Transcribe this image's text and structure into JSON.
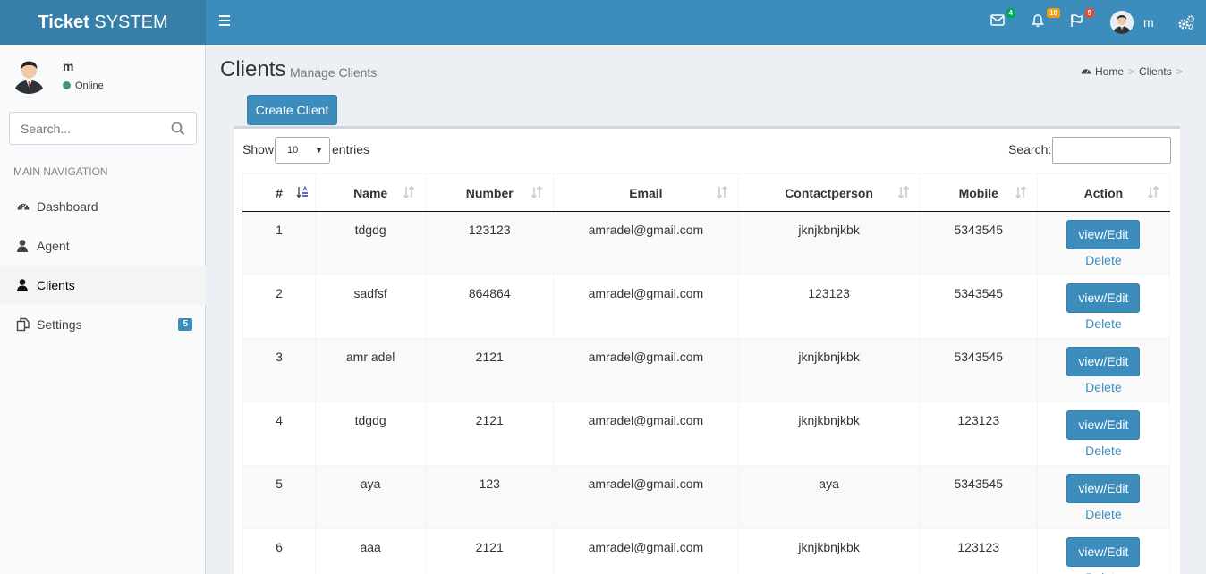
{
  "header": {
    "logo_bold": "Ticket",
    "logo_rest": "SYSTEM",
    "messages_count": "4",
    "notifications_count": "10",
    "tasks_count": "9",
    "user_name": "m",
    "colors": {
      "bar": "#3c8dbc",
      "logo_bg": "#367fa9",
      "badge_green": "#00a65a",
      "badge_yellow": "#f39c12",
      "badge_red": "#dd4b39"
    }
  },
  "sidebar": {
    "user_name": "m",
    "status": "Online",
    "search_placeholder": "Search...",
    "nav_header": "MAIN NAVIGATION",
    "items": [
      {
        "label": "Dashboard",
        "icon": "dashboard-icon"
      },
      {
        "label": "Agent",
        "icon": "user-icon"
      },
      {
        "label": "Clients",
        "icon": "user-icon",
        "active": true
      },
      {
        "label": "Settings",
        "icon": "copy-icon",
        "badge": "5"
      }
    ]
  },
  "content": {
    "title": "Clients",
    "subtitle": "Manage Clients",
    "breadcrumb": {
      "home": "Home",
      "current": "Clients",
      "sep": ">"
    },
    "create_button": "Create Client",
    "show_label": "Show",
    "entries_value": "10",
    "entries_label": "entries",
    "search_label": "Search:"
  },
  "table": {
    "columns": [
      "#",
      "Name",
      "Number",
      "Email",
      "Contactperson",
      "Mobile",
      "Action"
    ],
    "view_label": "view/Edit",
    "delete_label": "Delete",
    "rows": [
      {
        "id": "1",
        "name": "tdgdg",
        "number": "123123",
        "email": "amradel@gmail.com",
        "contact": "jknjkbnjkbk",
        "mobile": "5343545"
      },
      {
        "id": "2",
        "name": "sadfsf",
        "number": "864864",
        "email": "amradel@gmail.com",
        "contact": "123123",
        "mobile": "5343545"
      },
      {
        "id": "3",
        "name": "amr adel",
        "number": "2121",
        "email": "amradel@gmail.com",
        "contact": "jknjkbnjkbk",
        "mobile": "5343545"
      },
      {
        "id": "4",
        "name": "tdgdg",
        "number": "2121",
        "email": "amradel@gmail.com",
        "contact": "jknjkbnjkbk",
        "mobile": "123123"
      },
      {
        "id": "5",
        "name": "aya",
        "number": "123",
        "email": "amradel@gmail.com",
        "contact": "aya",
        "mobile": "5343545"
      },
      {
        "id": "6",
        "name": "aaa",
        "number": "2121",
        "email": "amradel@gmail.com",
        "contact": "jknjkbnjkbk",
        "mobile": "123123"
      }
    ]
  }
}
